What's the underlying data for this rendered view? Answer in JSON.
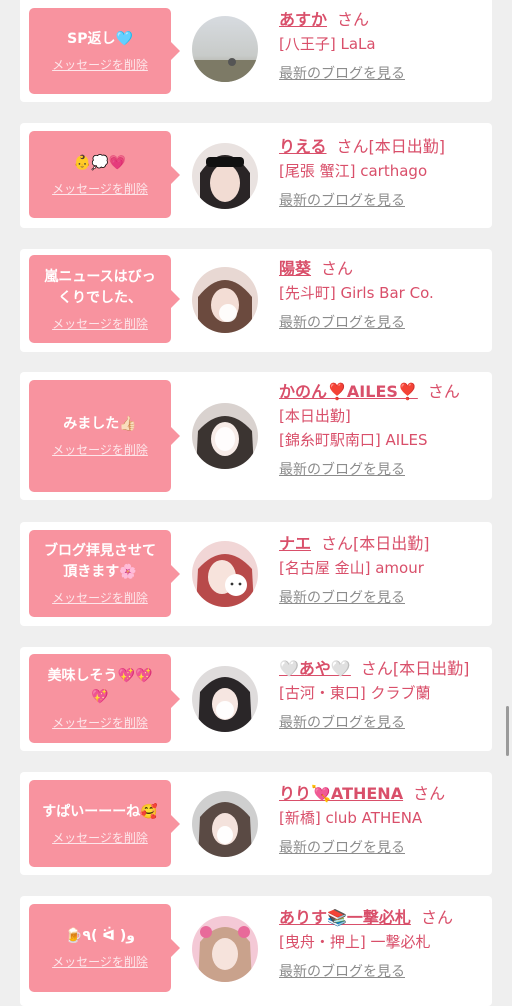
{
  "delete_label": "メッセージを削除",
  "blog_label": "最新のブログを見る",
  "san_label": "さん",
  "entries": [
    {
      "message": "SP返し🩵",
      "name": "あすか",
      "status": "",
      "location": "[八王子] LaLa"
    },
    {
      "message": "👶💭💗",
      "name": "りえる",
      "status": "[本日出勤]",
      "location": "[尾張 蟹江] carthago"
    },
    {
      "message": "嵐ニュースはびっ\nくりでした、",
      "name": "陽葵",
      "status": "",
      "location": "[先斗町] Girls Bar Co."
    },
    {
      "message": "みました👍🏻",
      "name": "かのん❣️AILES❣️",
      "status": "",
      "line2": "[本日出勤]",
      "location": "[錦糸町駅南口] AILES"
    },
    {
      "message": "ブログ拝見させて\n頂きます🌸",
      "name": "ナエ",
      "status": "[本日出勤]",
      "location": "[名古屋 金山] amour"
    },
    {
      "message": "美味しそう💖💖\n💖",
      "name": "🤍あや🤍",
      "status": "[本日出勤]",
      "location": "[古河・東口] クラブ蘭"
    },
    {
      "message": "すぱいーーーね🥰",
      "name": "りり💘ATHENA",
      "status": "",
      "location": "[新橋] club ATHENA"
    },
    {
      "message": "🍺٩( ᐛ )و",
      "name": "ありす📚一撃必札",
      "status": "",
      "location": "[曳舟・押上] 一撃必札"
    }
  ]
}
